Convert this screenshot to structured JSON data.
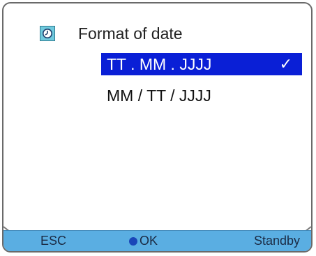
{
  "menu": {
    "title": "Format of date",
    "icon": "clock-icon",
    "options": [
      {
        "label": "TT . MM . JJJJ",
        "selected": true,
        "checkmark": "✓"
      },
      {
        "label": "MM / TT / JJJJ",
        "selected": false
      }
    ]
  },
  "softkeys": {
    "left": "ESC",
    "center": "OK",
    "right": "Standby"
  },
  "colors": {
    "selection": "#0a1fd6",
    "bottom_bar": "#5aaee2",
    "icon": "#6fc9dd",
    "ok_dot": "#1a46b8"
  }
}
